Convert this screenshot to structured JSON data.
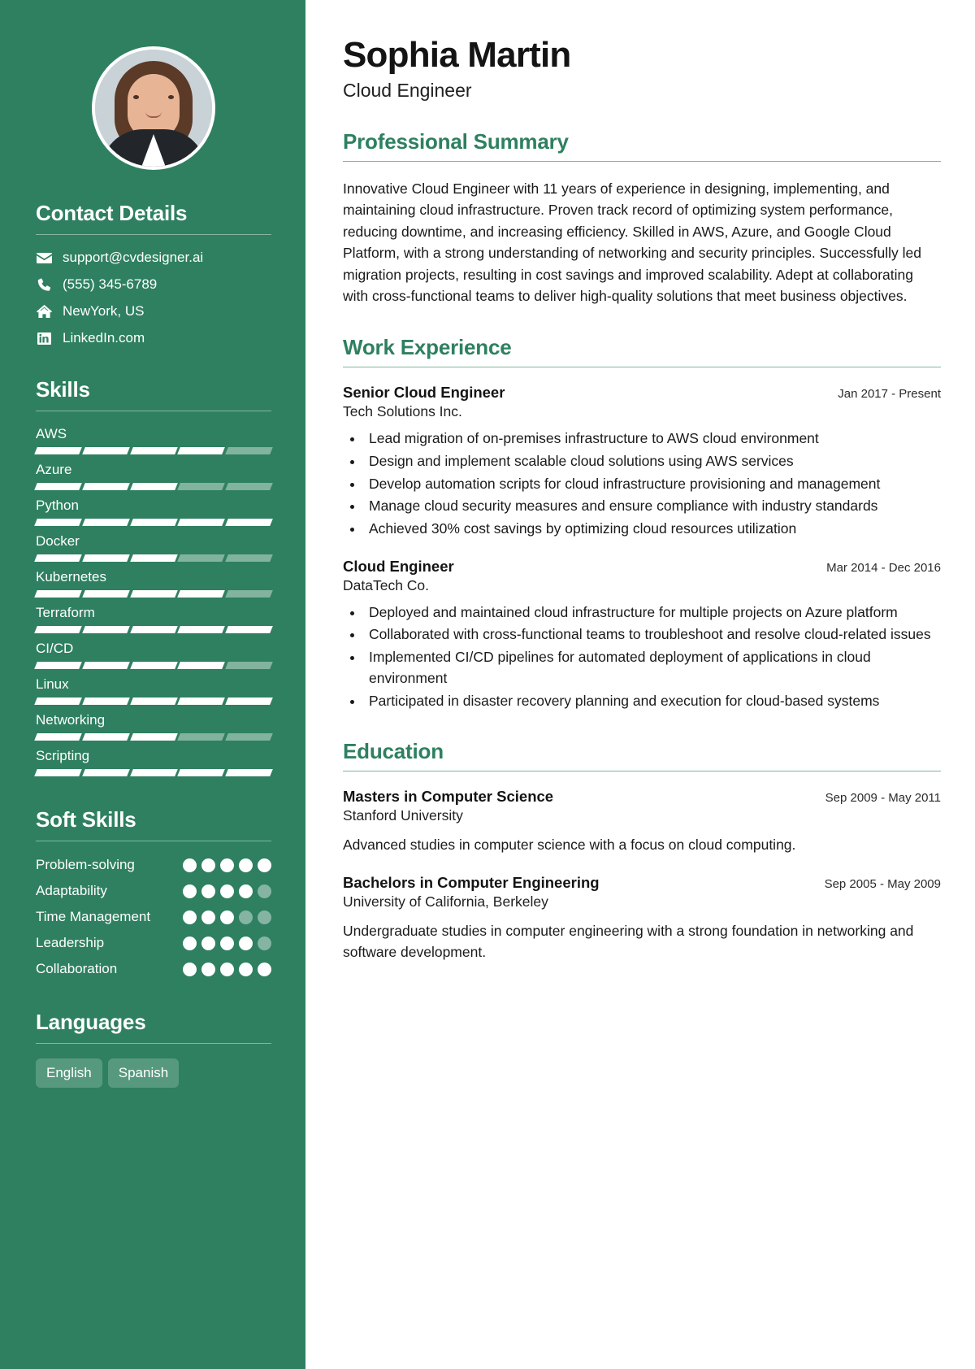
{
  "theme": {
    "sidebar_bg": "#2e8060",
    "accent": "#2e8060",
    "text": "#1a1a1a"
  },
  "header": {
    "name": "Sophia Martin",
    "role": "Cloud Engineer"
  },
  "sidebar": {
    "avatar_alt": "profile-photo",
    "contact": {
      "title": "Contact Details",
      "items": [
        {
          "icon": "envelope-icon",
          "value": "support@cvdesigner.ai"
        },
        {
          "icon": "phone-icon",
          "value": "(555) 345-6789"
        },
        {
          "icon": "home-icon",
          "value": "NewYork, US"
        },
        {
          "icon": "linkedin-icon",
          "value": "LinkedIn.com"
        }
      ]
    },
    "skills": {
      "title": "Skills",
      "max": 5,
      "items": [
        {
          "label": "AWS",
          "level": 4
        },
        {
          "label": "Azure",
          "level": 3
        },
        {
          "label": "Python",
          "level": 5
        },
        {
          "label": "Docker",
          "level": 3
        },
        {
          "label": "Kubernetes",
          "level": 4
        },
        {
          "label": "Terraform",
          "level": 5
        },
        {
          "label": "CI/CD",
          "level": 4
        },
        {
          "label": "Linux",
          "level": 5
        },
        {
          "label": "Networking",
          "level": 3
        },
        {
          "label": "Scripting",
          "level": 5
        }
      ]
    },
    "soft_skills": {
      "title": "Soft Skills",
      "max": 5,
      "items": [
        {
          "label": "Problem-solving",
          "level": 5
        },
        {
          "label": "Adaptability",
          "level": 4
        },
        {
          "label": "Time Management",
          "level": 3
        },
        {
          "label": "Leadership",
          "level": 4
        },
        {
          "label": "Collaboration",
          "level": 5
        }
      ]
    },
    "languages": {
      "title": "Languages",
      "items": [
        "English",
        "Spanish"
      ]
    }
  },
  "main": {
    "summary": {
      "title": "Professional Summary",
      "text": "Innovative Cloud Engineer with 11 years of experience in designing, implementing, and maintaining cloud infrastructure. Proven track record of optimizing system performance, reducing downtime, and increasing efficiency. Skilled in AWS, Azure, and Google Cloud Platform, with a strong understanding of networking and security principles. Successfully led migration projects, resulting in cost savings and improved scalability. Adept at collaborating with cross-functional teams to deliver high-quality solutions that meet business objectives."
    },
    "work": {
      "title": "Work Experience",
      "entries": [
        {
          "title": "Senior Cloud Engineer",
          "company": "Tech Solutions Inc.",
          "date": "Jan 2017 - Present",
          "bullets": [
            "Lead migration of on-premises infrastructure to AWS cloud environment",
            "Design and implement scalable cloud solutions using AWS services",
            "Develop automation scripts for cloud infrastructure provisioning and management",
            "Manage cloud security measures and ensure compliance with industry standards",
            "Achieved 30% cost savings by optimizing cloud resources utilization"
          ]
        },
        {
          "title": "Cloud Engineer",
          "company": "DataTech Co.",
          "date": "Mar 2014 - Dec 2016",
          "bullets": [
            "Deployed and maintained cloud infrastructure for multiple projects on Azure platform",
            "Collaborated with cross-functional teams to troubleshoot and resolve cloud-related issues",
            "Implemented CI/CD pipelines for automated deployment of applications in cloud environment",
            "Participated in disaster recovery planning and execution for cloud-based systems"
          ]
        }
      ]
    },
    "education": {
      "title": "Education",
      "entries": [
        {
          "title": "Masters in Computer Science",
          "school": "Stanford University",
          "date": "Sep 2009 - May 2011",
          "description": "Advanced studies in computer science with a focus on cloud computing."
        },
        {
          "title": "Bachelors in Computer Engineering",
          "school": "University of California, Berkeley",
          "date": "Sep 2005 - May 2009",
          "description": "Undergraduate studies in computer engineering with a strong foundation in networking and software development."
        }
      ]
    }
  }
}
